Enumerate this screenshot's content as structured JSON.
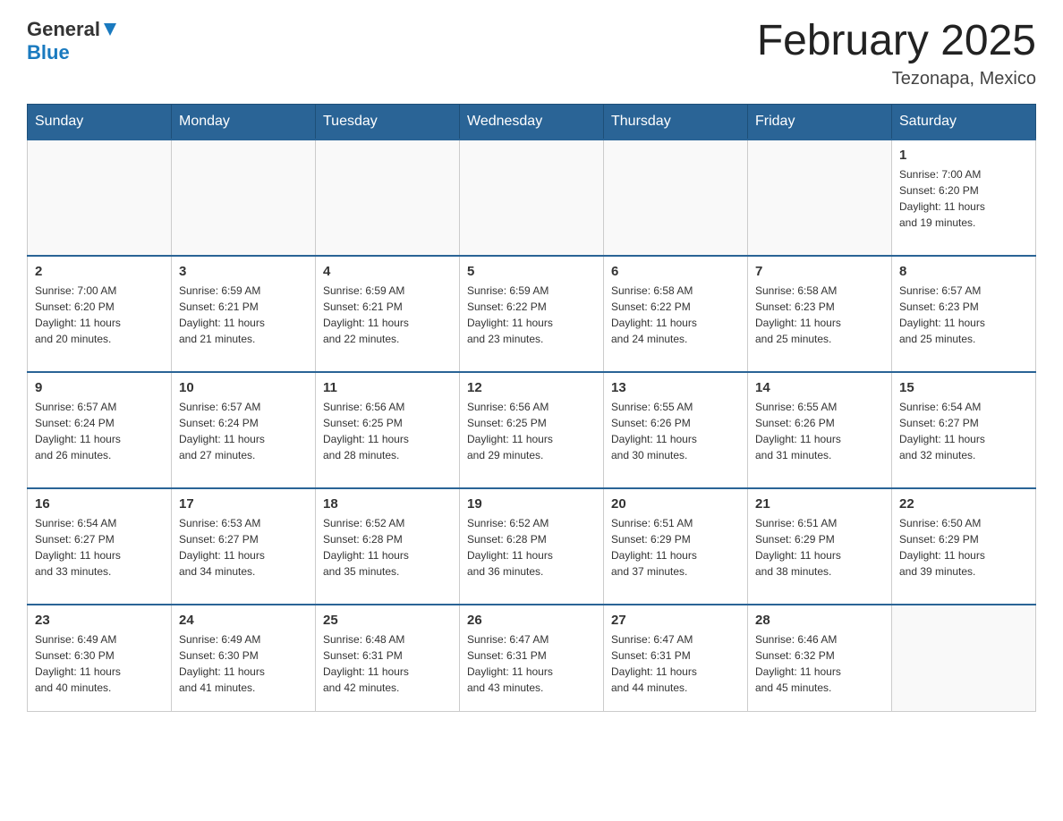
{
  "header": {
    "logo_general": "General",
    "logo_blue": "Blue",
    "title": "February 2025",
    "location": "Tezonapa, Mexico"
  },
  "weekdays": [
    "Sunday",
    "Monday",
    "Tuesday",
    "Wednesday",
    "Thursday",
    "Friday",
    "Saturday"
  ],
  "weeks": [
    [
      {
        "day": "",
        "info": ""
      },
      {
        "day": "",
        "info": ""
      },
      {
        "day": "",
        "info": ""
      },
      {
        "day": "",
        "info": ""
      },
      {
        "day": "",
        "info": ""
      },
      {
        "day": "",
        "info": ""
      },
      {
        "day": "1",
        "info": "Sunrise: 7:00 AM\nSunset: 6:20 PM\nDaylight: 11 hours\nand 19 minutes."
      }
    ],
    [
      {
        "day": "2",
        "info": "Sunrise: 7:00 AM\nSunset: 6:20 PM\nDaylight: 11 hours\nand 20 minutes."
      },
      {
        "day": "3",
        "info": "Sunrise: 6:59 AM\nSunset: 6:21 PM\nDaylight: 11 hours\nand 21 minutes."
      },
      {
        "day": "4",
        "info": "Sunrise: 6:59 AM\nSunset: 6:21 PM\nDaylight: 11 hours\nand 22 minutes."
      },
      {
        "day": "5",
        "info": "Sunrise: 6:59 AM\nSunset: 6:22 PM\nDaylight: 11 hours\nand 23 minutes."
      },
      {
        "day": "6",
        "info": "Sunrise: 6:58 AM\nSunset: 6:22 PM\nDaylight: 11 hours\nand 24 minutes."
      },
      {
        "day": "7",
        "info": "Sunrise: 6:58 AM\nSunset: 6:23 PM\nDaylight: 11 hours\nand 25 minutes."
      },
      {
        "day": "8",
        "info": "Sunrise: 6:57 AM\nSunset: 6:23 PM\nDaylight: 11 hours\nand 25 minutes."
      }
    ],
    [
      {
        "day": "9",
        "info": "Sunrise: 6:57 AM\nSunset: 6:24 PM\nDaylight: 11 hours\nand 26 minutes."
      },
      {
        "day": "10",
        "info": "Sunrise: 6:57 AM\nSunset: 6:24 PM\nDaylight: 11 hours\nand 27 minutes."
      },
      {
        "day": "11",
        "info": "Sunrise: 6:56 AM\nSunset: 6:25 PM\nDaylight: 11 hours\nand 28 minutes."
      },
      {
        "day": "12",
        "info": "Sunrise: 6:56 AM\nSunset: 6:25 PM\nDaylight: 11 hours\nand 29 minutes."
      },
      {
        "day": "13",
        "info": "Sunrise: 6:55 AM\nSunset: 6:26 PM\nDaylight: 11 hours\nand 30 minutes."
      },
      {
        "day": "14",
        "info": "Sunrise: 6:55 AM\nSunset: 6:26 PM\nDaylight: 11 hours\nand 31 minutes."
      },
      {
        "day": "15",
        "info": "Sunrise: 6:54 AM\nSunset: 6:27 PM\nDaylight: 11 hours\nand 32 minutes."
      }
    ],
    [
      {
        "day": "16",
        "info": "Sunrise: 6:54 AM\nSunset: 6:27 PM\nDaylight: 11 hours\nand 33 minutes."
      },
      {
        "day": "17",
        "info": "Sunrise: 6:53 AM\nSunset: 6:27 PM\nDaylight: 11 hours\nand 34 minutes."
      },
      {
        "day": "18",
        "info": "Sunrise: 6:52 AM\nSunset: 6:28 PM\nDaylight: 11 hours\nand 35 minutes."
      },
      {
        "day": "19",
        "info": "Sunrise: 6:52 AM\nSunset: 6:28 PM\nDaylight: 11 hours\nand 36 minutes."
      },
      {
        "day": "20",
        "info": "Sunrise: 6:51 AM\nSunset: 6:29 PM\nDaylight: 11 hours\nand 37 minutes."
      },
      {
        "day": "21",
        "info": "Sunrise: 6:51 AM\nSunset: 6:29 PM\nDaylight: 11 hours\nand 38 minutes."
      },
      {
        "day": "22",
        "info": "Sunrise: 6:50 AM\nSunset: 6:29 PM\nDaylight: 11 hours\nand 39 minutes."
      }
    ],
    [
      {
        "day": "23",
        "info": "Sunrise: 6:49 AM\nSunset: 6:30 PM\nDaylight: 11 hours\nand 40 minutes."
      },
      {
        "day": "24",
        "info": "Sunrise: 6:49 AM\nSunset: 6:30 PM\nDaylight: 11 hours\nand 41 minutes."
      },
      {
        "day": "25",
        "info": "Sunrise: 6:48 AM\nSunset: 6:31 PM\nDaylight: 11 hours\nand 42 minutes."
      },
      {
        "day": "26",
        "info": "Sunrise: 6:47 AM\nSunset: 6:31 PM\nDaylight: 11 hours\nand 43 minutes."
      },
      {
        "day": "27",
        "info": "Sunrise: 6:47 AM\nSunset: 6:31 PM\nDaylight: 11 hours\nand 44 minutes."
      },
      {
        "day": "28",
        "info": "Sunrise: 6:46 AM\nSunset: 6:32 PM\nDaylight: 11 hours\nand 45 minutes."
      },
      {
        "day": "",
        "info": ""
      }
    ]
  ]
}
